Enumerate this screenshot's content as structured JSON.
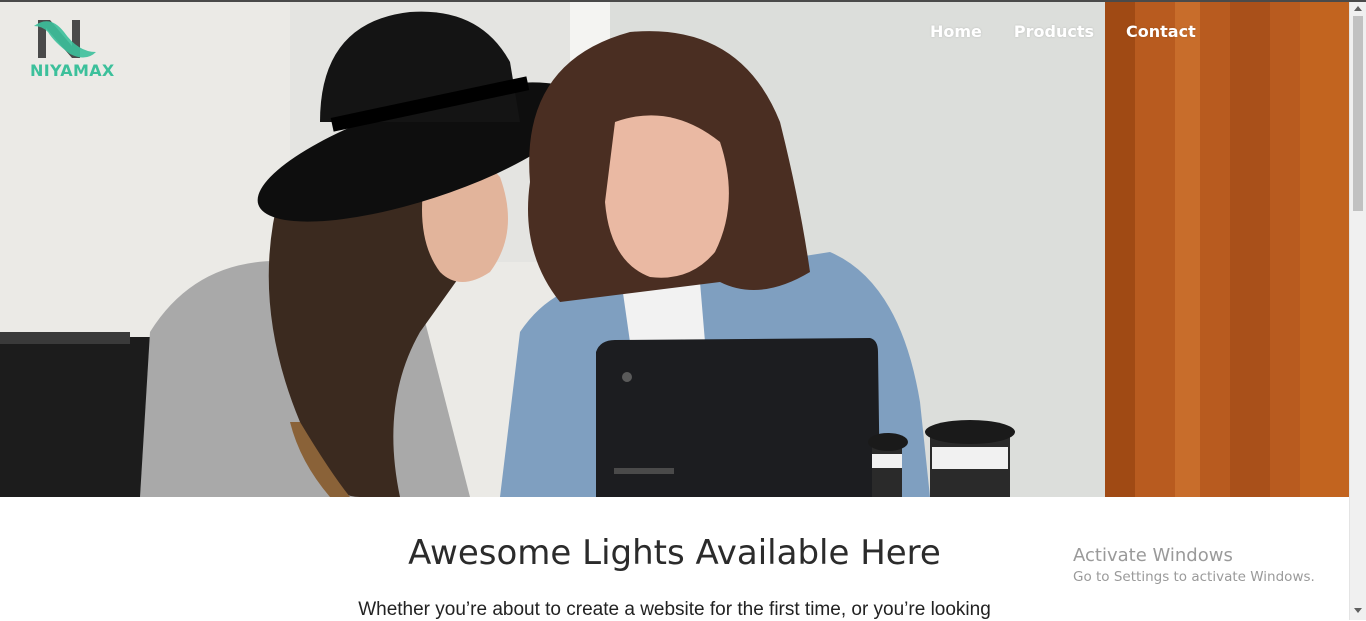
{
  "brand": {
    "name": "NIYAMAX",
    "logo_letter": "N"
  },
  "nav": {
    "items": [
      "Home",
      "Products",
      "Contact"
    ]
  },
  "hero": {
    "image_alt": "Two women looking at a laptop"
  },
  "content": {
    "headline": "Awesome Lights Available Here",
    "intro": "Whether you’re about to create a website for the first time, or you’re looking"
  },
  "watermark": {
    "title": "Activate Windows",
    "subtitle": "Go to Settings to activate Windows."
  },
  "colors": {
    "brand": "#3cc09b",
    "text": "#2b2b2b"
  }
}
